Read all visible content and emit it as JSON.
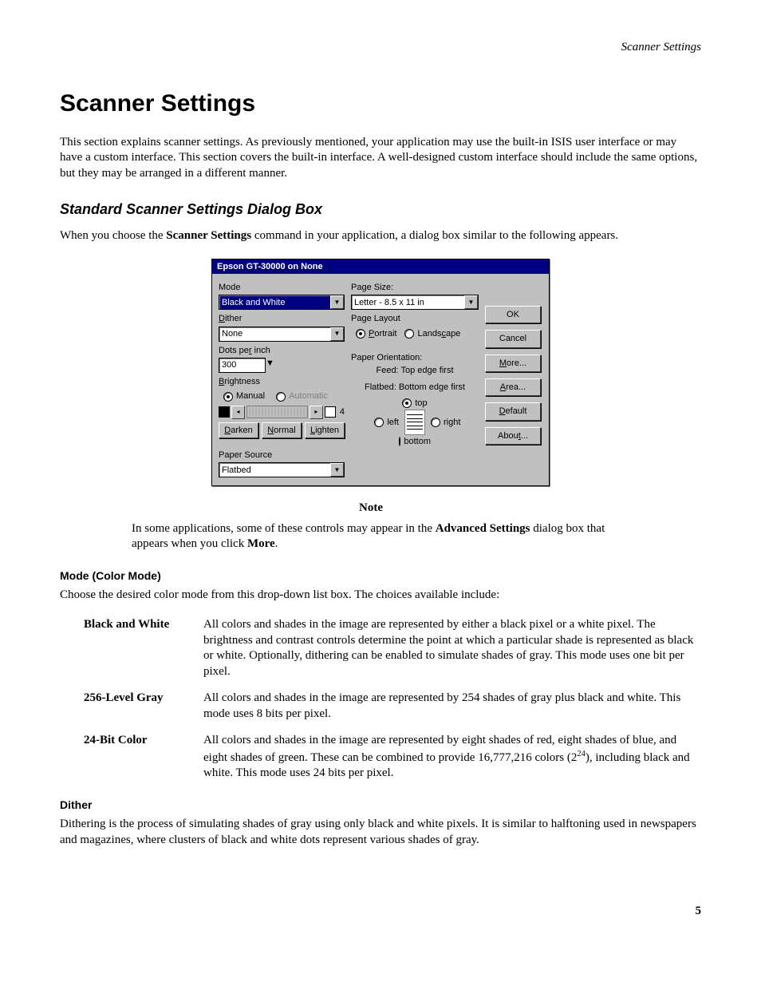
{
  "runningHeader": "Scanner Settings",
  "title": "Scanner Settings",
  "intro": "This section explains scanner settings. As previously mentioned, your application may use the built-in ISIS user interface or may have a custom interface. This section covers the built-in interface. A well-designed custom interface should include the same options, but they may be arranged in a different manner.",
  "section1": "Standard Scanner Settings Dialog Box",
  "para1a": "When you choose the ",
  "para1b": "Scanner Settings",
  "para1c": " command in your application, a dialog box similar to the following appears.",
  "dialog": {
    "title": "Epson GT-30000 on None",
    "labels": {
      "mode": "Mode",
      "dither": "Dither",
      "dpi": "Dots per inch",
      "brightness": "Brightness",
      "manual": "Manual",
      "automatic": "Automatic",
      "darken": "Darken",
      "normal": "Normal",
      "lighten": "Lighten",
      "paperSource": "Paper Source",
      "pageSize": "Page Size:",
      "pageLayout": "Page Layout",
      "portrait": "Portrait",
      "landscape": "Landscape",
      "paperOrientation": "Paper Orientation:",
      "feed": "Feed: Top edge first",
      "flatbed": "Flatbed: Bottom edge first",
      "top": "top",
      "left": "left",
      "right": "right",
      "bottom": "bottom",
      "brightnessVal": "4"
    },
    "values": {
      "mode": "Black and White",
      "dither": "None",
      "dpi": "300",
      "paperSource": "Flatbed",
      "pageSize": "Letter - 8.5 x 11 in"
    },
    "buttons": {
      "ok": "OK",
      "cancel": "Cancel",
      "more": "More...",
      "area": "Area...",
      "defaultb": "Default",
      "about": "About..."
    }
  },
  "noteTitle": "Note",
  "note1": "In some applications, some of these controls may appear in the ",
  "noteBold1": "Advanced Settings",
  "note2": " dialog box that appears when you click ",
  "noteBold2": "More",
  "note3": ".",
  "sub1": "Mode (Color Mode)",
  "sub1text": "Choose the desired color mode from this drop-down list box. The choices available include:",
  "modes": [
    {
      "name": "Black and White",
      "desc": "All colors and shades in the image are represented by either a black pixel or a white pixel. The brightness and contrast controls determine the point at which a particular shade is represented as black or white. Optionally, dithering can be enabled to simulate shades of gray. This mode uses one bit per pixel."
    },
    {
      "name": "256-Level Gray",
      "desc": "All colors and shades in the image are represented by 254 shades of gray plus black and white. This mode uses 8 bits per pixel."
    },
    {
      "name": "24-Bit Color",
      "desc_a": "All colors and shades in the image are represented by eight shades of red, eight shades of blue, and eight shades of green. These can be combined to provide 16,777,216 colors (2",
      "desc_sup": "24",
      "desc_b": "), including black and white. This mode uses 24 bits per pixel."
    }
  ],
  "sub2": "Dither",
  "sub2text": "Dithering is the process of simulating shades of gray using only black and white pixels. It is similar to halftoning used in newspapers and magazines, where clusters of black and white dots represent various shades of gray.",
  "pageNumber": "5"
}
